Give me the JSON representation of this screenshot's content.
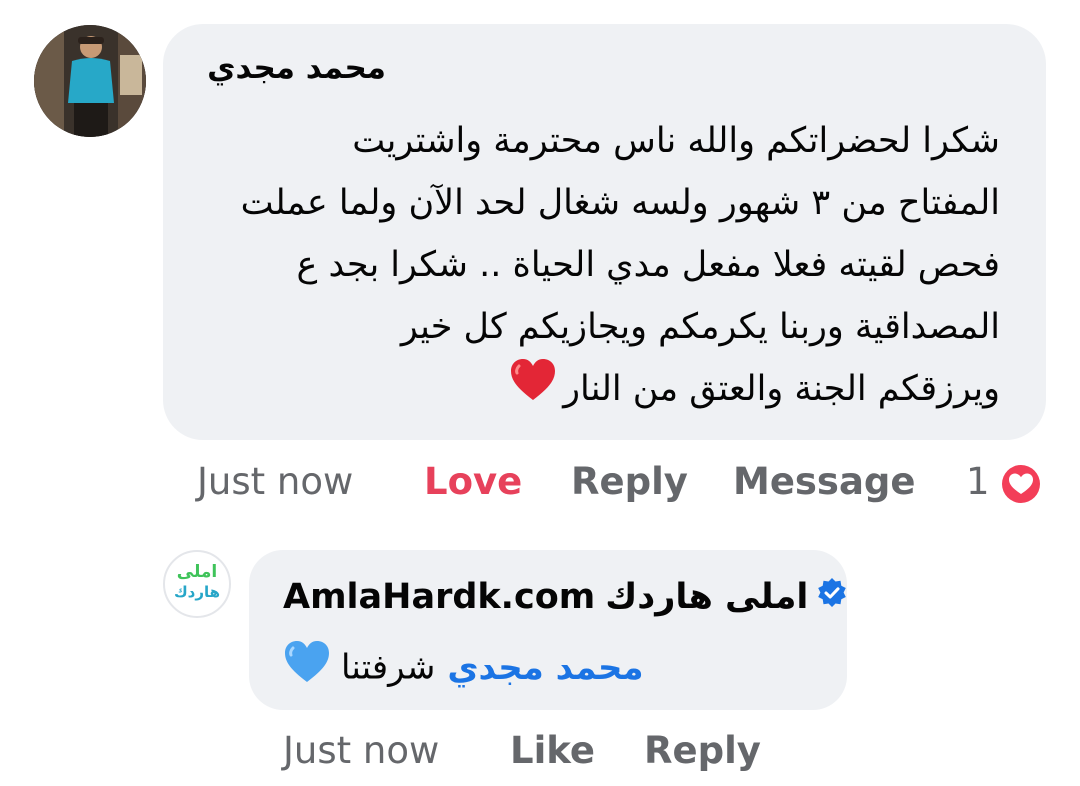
{
  "comment": {
    "author": "محمد مجدي",
    "lines": [
      "شكرا لحضراتكم والله ناس محترمة واشتريت",
      "المفتاح من ٣ شهور ولسه شغال لحد الآن ولما عملت",
      "فحص لقيته فعلا مفعل مدي الحياة .. شكرا بجد ع",
      "المصداقية وربنا يكرمكم ويجازيكم كل خير",
      "ويرزقكم الجنة والعتق من النار"
    ],
    "emoji": "red-heart-emoji",
    "time": "Just now",
    "love_label": "Love",
    "reply_label": "Reply",
    "message_label": "Message",
    "reaction_count": "1",
    "reaction_icon": "love-reaction-icon"
  },
  "reply": {
    "author_site": "AmlaHardk.com",
    "author_ar": "املى هاردك",
    "verified_icon": "verified-badge-icon",
    "mention": "محمد مجدي",
    "text": "شرفتنا",
    "emoji": "blue-heart-emoji",
    "avatar_logo_line1": "املى",
    "avatar_logo_line2": "هاردك",
    "time": "Just now",
    "like_label": "Like",
    "reply_label": "Reply"
  },
  "colors": {
    "bubble": "#eff1f4",
    "love": "#e7415b",
    "link_blue": "#1b74e4",
    "meta_gray": "#65676b"
  }
}
